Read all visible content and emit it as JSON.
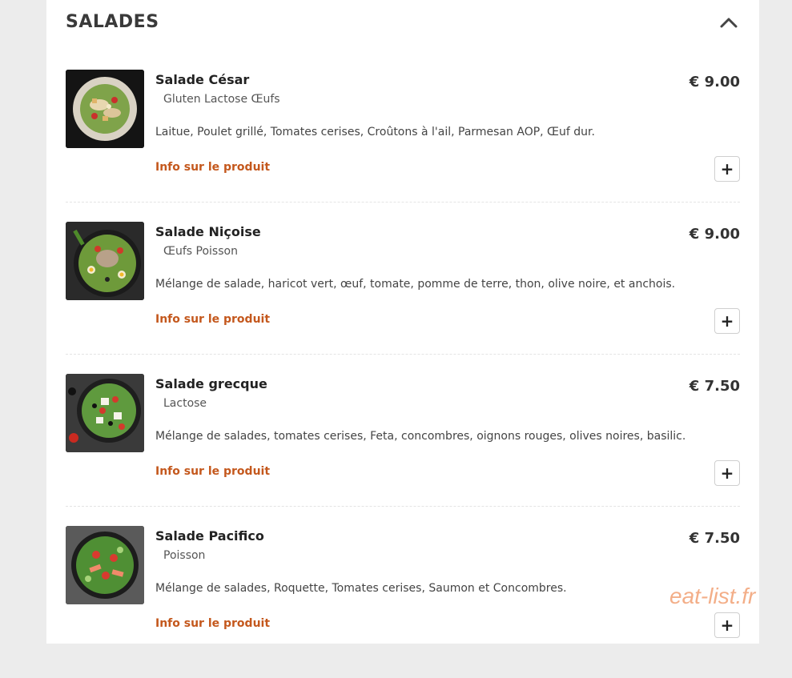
{
  "section": {
    "title": "SALADES",
    "collapse_icon": "chevron-up-icon"
  },
  "items": [
    {
      "name": "Salade César",
      "allergens": "Gluten Lactose Œufs",
      "description": "Laitue, Poulet grillé, Tomates cerises, Croûtons à l'ail, Parmesan AOP, Œuf dur.",
      "info_label": "Info sur le produit",
      "price": "€ 9.00",
      "add_label": "+"
    },
    {
      "name": "Salade Niçoise",
      "allergens": "Œufs Poisson",
      "description": "Mélange de salade, haricot vert, œuf, tomate, pomme de terre, thon, olive noire, et anchois.",
      "info_label": "Info sur le produit",
      "price": "€ 9.00",
      "add_label": "+"
    },
    {
      "name": "Salade grecque",
      "allergens": "Lactose",
      "description": "Mélange de salades, tomates cerises, Feta, concombres, oignons rouges, olives noires, basilic.",
      "info_label": "Info sur le produit",
      "price": "€ 7.50",
      "add_label": "+"
    },
    {
      "name": "Salade Pacifico",
      "allergens": "Poisson",
      "description": "Mélange de salades, Roquette, Tomates cerises, Saumon et Concombres.",
      "info_label": "Info sur le produit",
      "price": "€ 7.50",
      "add_label": "+"
    }
  ],
  "watermark": "eat-list.fr",
  "colors": {
    "accent": "#c4581d",
    "watermark": "#f2a67c"
  }
}
